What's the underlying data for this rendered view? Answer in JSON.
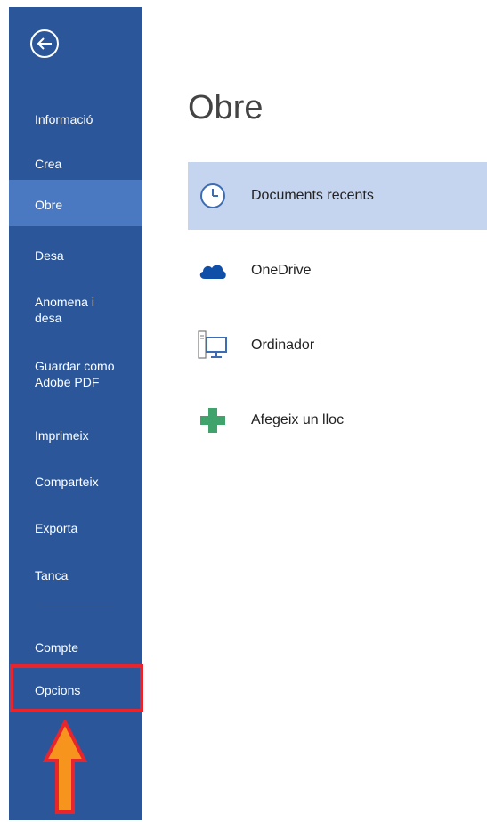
{
  "sidebar": {
    "items": [
      {
        "label": "Informació"
      },
      {
        "label": "Crea"
      },
      {
        "label": "Obre",
        "selected": true
      },
      {
        "label": "Desa"
      },
      {
        "label": "Anomena i desa"
      },
      {
        "label": "Guardar como Adobe PDF"
      },
      {
        "label": "Imprimeix"
      },
      {
        "label": "Comparteix"
      },
      {
        "label": "Exporta"
      },
      {
        "label": "Tanca"
      },
      {
        "label": "Compte"
      },
      {
        "label": "Opcions",
        "highlighted": true
      }
    ]
  },
  "main": {
    "title": "Obre",
    "locations": [
      {
        "label": "Documents recents",
        "icon": "clock-icon",
        "selected": true
      },
      {
        "label": "OneDrive",
        "icon": "cloud-icon"
      },
      {
        "label": "Ordinador",
        "icon": "computer-icon"
      },
      {
        "label": "Afegeix un lloc",
        "icon": "plus-icon"
      }
    ]
  },
  "colors": {
    "sidebar_bg": "#2b579a",
    "sidebar_selected": "#4a78c1",
    "content_selected": "#c5d5ef",
    "highlight_border": "#e8252c",
    "arrow_fill": "#f7941d",
    "onedrive_blue": "#0f4fa8",
    "plus_green": "#3fa36b"
  }
}
